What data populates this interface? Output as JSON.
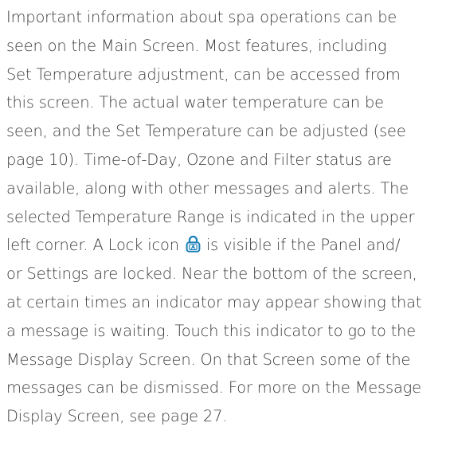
{
  "paragraph": {
    "lines": [
      "Important information about spa operations can be",
      "seen on the Main Screen. Most features, including",
      "Set Temperature adjustment, can be accessed from",
      "this screen. The actual water temperature can be",
      "seen, and the Set Temperature can be adjusted (see",
      "page 10). Time-of-Day, Ozone and Filter status are",
      "available, along with other messages and alerts. The",
      "selected Temperature Range is indicated in the upper"
    ],
    "lock_line_before": "left corner. A Lock icon",
    "lock_icon": "lock-icon",
    "lock_line_after": "is visible if the Panel and/",
    "lines_after": [
      "or Settings are locked. Near the bottom of the screen,",
      "at certain times an indicator may appear showing that",
      "a message is waiting. Touch this indicator to go to the",
      "Message Display Screen. On that Screen some of the",
      "messages can be dismissed. For more on the Message",
      "Display Screen, see page 27."
    ]
  },
  "colors": {
    "text": "#3a3a3a",
    "icon": "#1a7fb8"
  }
}
